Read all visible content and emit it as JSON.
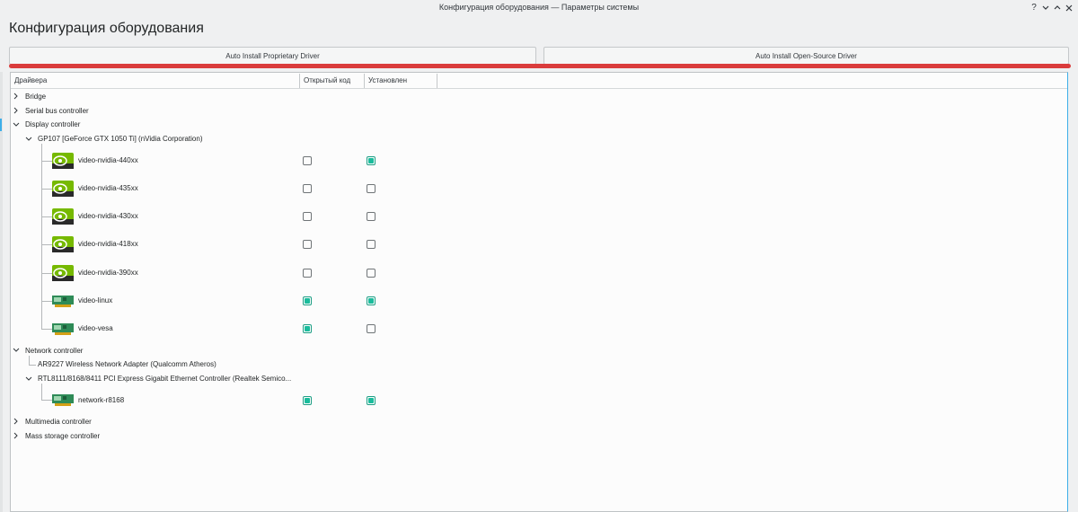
{
  "window": {
    "title": "Конфигурация оборудования — Параметры системы",
    "help_glyph": "?",
    "min_glyph": "⌄",
    "max_glyph": "⌃",
    "close_glyph": "✕"
  },
  "page": {
    "title": "Конфигурация оборудования"
  },
  "actions": {
    "proprietary_label": "Auto Install Proprietary Driver",
    "opensource_label": "Auto Install Open-Source Driver"
  },
  "table": {
    "col_drivers": "Драйвера",
    "col_open": "Открытый код",
    "col_installed": "Установлен"
  },
  "tree": {
    "bridge": "Bridge",
    "serial": "Serial bus controller",
    "display": "Display controller",
    "gpu": "GP107 [GeForce GTX 1050 Ti] (nVidia Corporation)",
    "drivers": [
      {
        "name": "video-nvidia-440xx",
        "icon": "nvidia-icon",
        "open_source": false,
        "installed": true
      },
      {
        "name": "video-nvidia-435xx",
        "icon": "nvidia-icon",
        "open_source": false,
        "installed": false
      },
      {
        "name": "video-nvidia-430xx",
        "icon": "nvidia-icon",
        "open_source": false,
        "installed": false
      },
      {
        "name": "video-nvidia-418xx",
        "icon": "nvidia-icon",
        "open_source": false,
        "installed": false
      },
      {
        "name": "video-nvidia-390xx",
        "icon": "nvidia-icon",
        "open_source": false,
        "installed": false
      },
      {
        "name": "video-linux",
        "icon": "video-card-icon",
        "open_source": true,
        "installed": true
      },
      {
        "name": "video-vesa",
        "icon": "video-card-icon",
        "open_source": true,
        "installed": false
      }
    ],
    "network": "Network controller",
    "wifi": "AR9227 Wireless Network Adapter (Qualcomm Atheros)",
    "ethernet": "RTL8111/8168/8411 PCI Express Gigabit Ethernet Controller (Realtek Semico...",
    "net_driver": {
      "name": "network-r8168",
      "icon": "network-card-icon",
      "open_source": true,
      "installed": true
    },
    "multimedia": "Multimedia controller",
    "storage": "Mass storage controller"
  },
  "colors": {
    "accent": "#3daee9",
    "check": "#1abc9c",
    "highlight_line": "#da3c3c"
  }
}
